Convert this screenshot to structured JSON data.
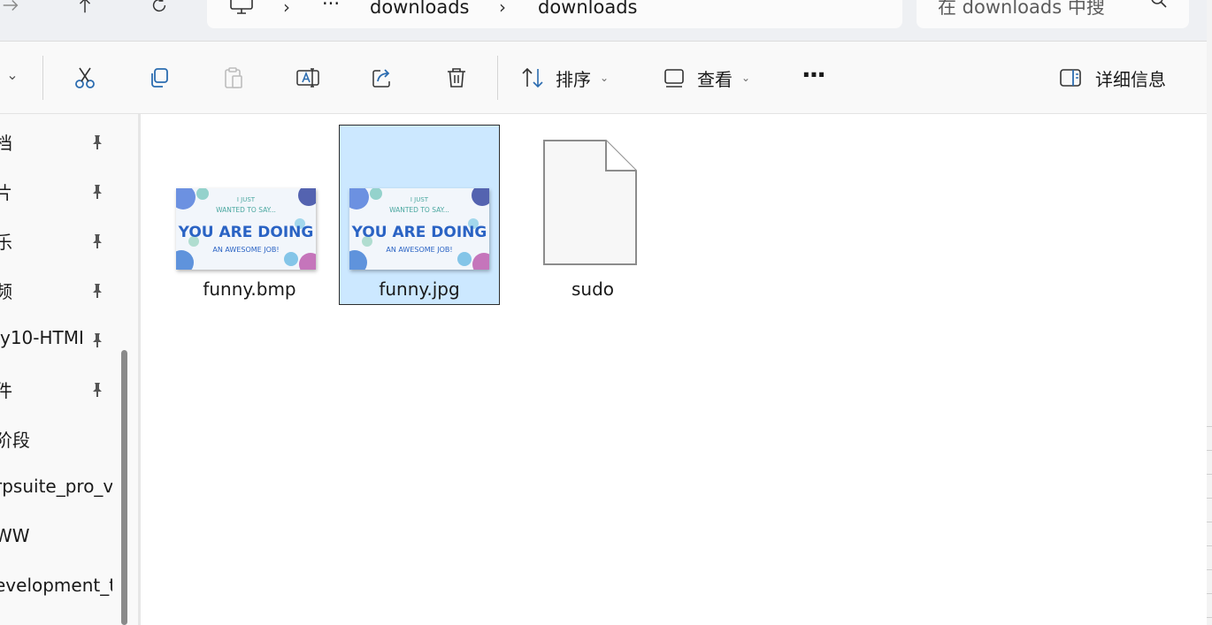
{
  "address": {
    "ellipsis": "···",
    "segments": [
      "downloads",
      "downloads"
    ],
    "separator": "›"
  },
  "search": {
    "placeholder": "在 downloads 中搜"
  },
  "toolbar": {
    "sort_label": "排序",
    "view_label": "查看",
    "more_label": "···",
    "details_label": "详细信息",
    "caret": "⌄"
  },
  "sidebar": {
    "items": [
      {
        "label": "档",
        "pinned": true
      },
      {
        "label": "片",
        "pinned": true
      },
      {
        "label": "乐",
        "pinned": true
      },
      {
        "label": "频",
        "pinned": true
      },
      {
        "label": "y10-HTMI",
        "pinned": true
      },
      {
        "label": "件",
        "pinned": true
      },
      {
        "label": "阶段",
        "pinned": false
      },
      {
        "label": "rpsuite_pro_v",
        "pinned": false
      },
      {
        "label": "WW",
        "pinned": false
      },
      {
        "label": "evelopment_t",
        "pinned": false
      }
    ]
  },
  "files": [
    {
      "name": "funny.bmp",
      "type": "image",
      "selected": false
    },
    {
      "name": "funny.jpg",
      "type": "image",
      "selected": true
    },
    {
      "name": "sudo",
      "type": "file",
      "selected": false
    }
  ],
  "thumbnail_text": {
    "line1": "I JUST",
    "line2": "WANTED TO SAY...",
    "line3": "YOU ARE DOING",
    "line4": "AN AWESOME JOB!"
  },
  "colors": {
    "selection": "#cce8ff",
    "accent": "#0067c0"
  }
}
